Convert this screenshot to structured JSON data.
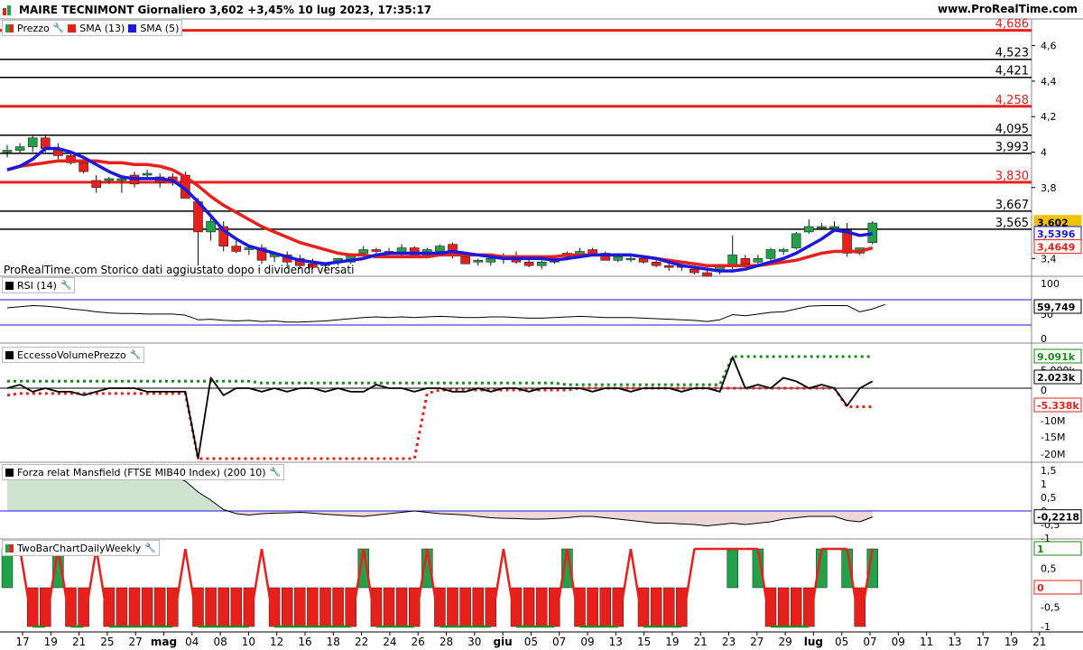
{
  "header": {
    "title": "MAIRE TECNIMONT Giornaliero 3,602 +3,45% 10 lug 2023, 17:35:17",
    "site": "www.ProRealTime.com"
  },
  "note": "ProRealTime.com  Storico dati aggiustato dopo i dividendi versati",
  "colors": {
    "up": "#22a04a",
    "down": "#e8201c",
    "sma13": "#e8201c",
    "sma5": "#1a1adc",
    "level_red": "#e8201c",
    "level_black": "#000000",
    "green_line": "#1a8a1a"
  },
  "legend": {
    "prezzo": "Prezzo",
    "sma13": "SMA (13)",
    "sma5": "SMA (5)"
  },
  "panels": {
    "rsi": {
      "label": "RSI (14)",
      "value_label": "59,749",
      "ticks": [
        "100",
        "50",
        "0"
      ]
    },
    "evp": {
      "label": "EccessoVolumePrezzo",
      "value_green": "9.091k",
      "value_black": "2.023k",
      "value_zero": "0",
      "value_red": "-5.338k",
      "ticks": [
        "5.000k",
        "-10M",
        "-15M",
        "-20M"
      ]
    },
    "mansfield": {
      "label": "Forza relat Mansfield (FTSE MIB40 Index) (200 10)",
      "value_label": "-0,2218",
      "ticks": [
        "1,5",
        "1",
        "0,5",
        "0",
        "-0,5",
        "-1"
      ]
    },
    "twobar": {
      "label": "TwoBarChartDailyWeekly",
      "value_top": "1",
      "value_zero": "0",
      "ticks": [
        "0,5",
        "-0,5",
        "-1"
      ]
    }
  },
  "x_axis": {
    "labels": [
      "17",
      "19",
      "21",
      "25",
      "27",
      "mag",
      "04",
      "08",
      "10",
      "12",
      "16",
      "18",
      "22",
      "24",
      "26",
      "28",
      "30",
      "giu",
      "05",
      "07",
      "09",
      "13",
      "15",
      "19",
      "21",
      "23",
      "27",
      "29",
      "lug",
      "05",
      "07",
      "09",
      "11",
      "13",
      "17",
      "19",
      "21"
    ],
    "bold": [
      "mag",
      "giu",
      "lug"
    ]
  },
  "chart_data": {
    "type": "candlestick",
    "price_ticks": [
      "4,6",
      "4,4",
      "4,2",
      "4",
      "3,8",
      "3,4"
    ],
    "ylim": [
      3.3,
      4.72
    ],
    "levels": [
      {
        "value": 4.686,
        "label": "4,686",
        "color": "red"
      },
      {
        "value": 4.523,
        "label": "4,523",
        "color": "black"
      },
      {
        "value": 4.421,
        "label": "4,421",
        "color": "black"
      },
      {
        "value": 4.258,
        "label": "4,258",
        "color": "red"
      },
      {
        "value": 4.095,
        "label": "4,095",
        "color": "black"
      },
      {
        "value": 3.993,
        "label": "3,993",
        "color": "black"
      },
      {
        "value": 3.83,
        "label": "3,830",
        "color": "red"
      },
      {
        "value": 3.667,
        "label": "3,667",
        "color": "black"
      },
      {
        "value": 3.565,
        "label": "3,565",
        "color": "black"
      }
    ],
    "last_price": "3,602",
    "sma5_last": "3,5396",
    "sma13_last": "3,4649",
    "candles": [
      [
        4.0,
        4.04,
        3.97,
        4.01
      ],
      [
        4.01,
        4.05,
        3.99,
        4.03
      ],
      [
        4.03,
        4.1,
        4.0,
        4.08
      ],
      [
        4.08,
        4.1,
        4.0,
        4.02
      ],
      [
        4.01,
        4.05,
        3.96,
        3.98
      ],
      [
        3.98,
        3.99,
        3.93,
        3.94
      ],
      [
        3.94,
        3.96,
        3.88,
        3.89
      ],
      [
        3.84,
        3.87,
        3.77,
        3.8
      ],
      [
        3.84,
        3.86,
        3.82,
        3.85
      ],
      [
        3.84,
        3.87,
        3.77,
        3.85
      ],
      [
        3.87,
        3.89,
        3.8,
        3.82
      ],
      [
        3.87,
        3.9,
        3.85,
        3.88
      ],
      [
        3.86,
        3.88,
        3.8,
        3.83
      ],
      [
        3.86,
        3.88,
        3.81,
        3.84
      ],
      [
        3.87,
        3.89,
        3.78,
        3.74
      ],
      [
        3.72,
        3.74,
        3.36,
        3.55
      ],
      [
        3.55,
        3.63,
        3.5,
        3.61
      ],
      [
        3.58,
        3.61,
        3.44,
        3.47
      ],
      [
        3.47,
        3.5,
        3.43,
        3.44
      ],
      [
        3.45,
        3.47,
        3.42,
        3.46
      ],
      [
        3.46,
        3.48,
        3.37,
        3.39
      ],
      [
        3.41,
        3.43,
        3.38,
        3.43
      ],
      [
        3.42,
        3.44,
        3.35,
        3.38
      ],
      [
        3.4,
        3.42,
        3.34,
        3.36
      ],
      [
        3.37,
        3.4,
        3.34,
        3.35
      ],
      [
        3.36,
        3.38,
        3.33,
        3.37
      ],
      [
        3.38,
        3.4,
        3.36,
        3.4
      ],
      [
        3.38,
        3.43,
        3.37,
        3.42
      ],
      [
        3.43,
        3.47,
        3.41,
        3.45
      ],
      [
        3.45,
        3.46,
        3.43,
        3.44
      ],
      [
        3.44,
        3.46,
        3.42,
        3.43
      ],
      [
        3.43,
        3.48,
        3.41,
        3.46
      ],
      [
        3.46,
        3.47,
        3.42,
        3.42
      ],
      [
        3.42,
        3.46,
        3.4,
        3.45
      ],
      [
        3.44,
        3.48,
        3.42,
        3.47
      ],
      [
        3.48,
        3.49,
        3.4,
        3.42
      ],
      [
        3.41,
        3.43,
        3.37,
        3.37
      ],
      [
        3.38,
        3.4,
        3.36,
        3.39
      ],
      [
        3.38,
        3.41,
        3.36,
        3.4
      ],
      [
        3.4,
        3.43,
        3.37,
        3.41
      ],
      [
        3.41,
        3.44,
        3.37,
        3.38
      ],
      [
        3.38,
        3.41,
        3.35,
        3.36
      ],
      [
        3.36,
        3.39,
        3.34,
        3.38
      ],
      [
        3.38,
        3.42,
        3.37,
        3.4
      ],
      [
        3.41,
        3.44,
        3.39,
        3.43
      ],
      [
        3.42,
        3.46,
        3.41,
        3.44
      ],
      [
        3.45,
        3.46,
        3.42,
        3.42
      ],
      [
        3.43,
        3.44,
        3.39,
        3.39
      ],
      [
        3.39,
        3.43,
        3.38,
        3.41
      ],
      [
        3.4,
        3.42,
        3.38,
        3.4
      ],
      [
        3.4,
        3.42,
        3.37,
        3.38
      ],
      [
        3.38,
        3.39,
        3.35,
        3.36
      ],
      [
        3.36,
        3.38,
        3.33,
        3.35
      ],
      [
        3.36,
        3.38,
        3.33,
        3.35
      ],
      [
        3.34,
        3.36,
        3.31,
        3.32
      ],
      [
        3.32,
        3.34,
        3.3,
        3.3
      ],
      [
        3.33,
        3.37,
        3.31,
        3.36
      ],
      [
        3.36,
        3.53,
        3.34,
        3.42
      ],
      [
        3.4,
        3.42,
        3.36,
        3.37
      ],
      [
        3.38,
        3.42,
        3.37,
        3.4
      ],
      [
        3.4,
        3.46,
        3.39,
        3.45
      ],
      [
        3.44,
        3.46,
        3.42,
        3.45
      ],
      [
        3.46,
        3.55,
        3.45,
        3.54
      ],
      [
        3.55,
        3.62,
        3.54,
        3.58
      ],
      [
        3.57,
        3.6,
        3.56,
        3.58
      ],
      [
        3.57,
        3.61,
        3.56,
        3.58
      ],
      [
        3.56,
        3.6,
        3.41,
        3.43
      ],
      [
        3.43,
        3.46,
        3.42,
        3.46
      ],
      [
        3.49,
        3.61,
        3.48,
        3.6
      ]
    ],
    "sma5": [
      3.9,
      3.92,
      3.96,
      4.02,
      4.02,
      4.0,
      3.97,
      3.93,
      3.89,
      3.86,
      3.85,
      3.85,
      3.85,
      3.84,
      3.79,
      3.72,
      3.64,
      3.56,
      3.51,
      3.47,
      3.45,
      3.43,
      3.41,
      3.39,
      3.38,
      3.37,
      3.38,
      3.39,
      3.4,
      3.42,
      3.43,
      3.43,
      3.43,
      3.43,
      3.43,
      3.44,
      3.43,
      3.42,
      3.41,
      3.4,
      3.4,
      3.4,
      3.4,
      3.39,
      3.4,
      3.41,
      3.42,
      3.42,
      3.42,
      3.42,
      3.41,
      3.4,
      3.38,
      3.36,
      3.35,
      3.34,
      3.33,
      3.33,
      3.34,
      3.36,
      3.38,
      3.4,
      3.43,
      3.47,
      3.51,
      3.56,
      3.55,
      3.53,
      3.54
    ],
    "sma13": [
      3.9,
      3.92,
      3.93,
      3.94,
      3.95,
      3.95,
      3.95,
      3.95,
      3.94,
      3.94,
      3.93,
      3.93,
      3.92,
      3.9,
      3.86,
      3.81,
      3.75,
      3.7,
      3.66,
      3.62,
      3.58,
      3.55,
      3.52,
      3.49,
      3.47,
      3.45,
      3.43,
      3.42,
      3.42,
      3.41,
      3.41,
      3.41,
      3.41,
      3.41,
      3.42,
      3.42,
      3.42,
      3.42,
      3.42,
      3.41,
      3.41,
      3.41,
      3.41,
      3.41,
      3.42,
      3.42,
      3.42,
      3.42,
      3.42,
      3.42,
      3.41,
      3.4,
      3.39,
      3.38,
      3.37,
      3.36,
      3.36,
      3.36,
      3.36,
      3.36,
      3.37,
      3.38,
      3.39,
      3.41,
      3.43,
      3.44,
      3.44,
      3.44,
      3.46
    ],
    "rsi": [
      54,
      56,
      58,
      57,
      55,
      52,
      50,
      47,
      45,
      44,
      44,
      43,
      43,
      43,
      41,
      33,
      34,
      32,
      31,
      32,
      30,
      31,
      29,
      29,
      30,
      31,
      33,
      35,
      37,
      38,
      37,
      38,
      37,
      38,
      39,
      38,
      37,
      37,
      38,
      38,
      37,
      36,
      36,
      37,
      38,
      39,
      38,
      37,
      37,
      37,
      36,
      35,
      34,
      33,
      32,
      30,
      33,
      42,
      40,
      43,
      46,
      47,
      52,
      57,
      58,
      58,
      58,
      47,
      52,
      60
    ],
    "evp_black": [
      0,
      1,
      -1,
      0,
      -1,
      -1,
      -2,
      -1,
      0,
      0,
      0,
      -1,
      -1,
      -1,
      -1,
      -20,
      3,
      -2,
      0,
      0,
      -1,
      0,
      -1,
      0,
      0,
      -1,
      0,
      -1,
      -1,
      1,
      0,
      0,
      -1,
      0,
      0,
      -1,
      -1,
      0,
      -1,
      0,
      0,
      -1,
      0,
      0,
      0,
      0,
      -1,
      0,
      0,
      -1,
      0,
      0,
      0,
      -1,
      0,
      0,
      -1,
      9,
      0,
      1,
      0,
      3,
      2,
      0,
      1,
      0,
      -5,
      0,
      2
    ],
    "evp_green": [
      2,
      2,
      2,
      2,
      2,
      2,
      2,
      2,
      2,
      2,
      2,
      2,
      2,
      2,
      2,
      2,
      2,
      2,
      2,
      2,
      1.5,
      1.5,
      1.5,
      1.5,
      1.5,
      1.5,
      1.5,
      1.5,
      1.5,
      1.5,
      1.5,
      1.5,
      1.5,
      1.5,
      1.5,
      1.5,
      1.5,
      1.5,
      1.5,
      1.5,
      1.5,
      1.5,
      1.5,
      1.5,
      1,
      1,
      1,
      1,
      1,
      1,
      1,
      1,
      1,
      1,
      1,
      1,
      1,
      9.1,
      9.1,
      9.1,
      9.1,
      9.1,
      9.1,
      9.1,
      9.1,
      9.1,
      9.1,
      9.1,
      9.1
    ],
    "evp_red": [
      -2,
      -1.5,
      -1.5,
      -1.5,
      -1.5,
      -1.5,
      -1.5,
      -1.5,
      -1.5,
      -1.5,
      -1.5,
      -1.5,
      -1.5,
      -1.5,
      -1.5,
      -20,
      -20,
      -20,
      -20,
      -20,
      -20,
      -20,
      -20,
      -20,
      -20,
      -20,
      -20,
      -20,
      -20,
      -20,
      -20,
      -20,
      -20,
      -1.5,
      -0.5,
      -0.5,
      -0.5,
      -0.5,
      -0.5,
      -0.5,
      -0.5,
      -0.5,
      -0.5,
      -0.5,
      -0.5,
      0,
      0,
      0,
      0,
      0,
      0,
      0,
      0,
      0,
      0,
      0,
      0,
      0,
      0,
      0,
      0,
      0,
      0,
      0,
      0,
      0,
      -5.3,
      -5.3,
      -5.3
    ],
    "mansfield": [
      1.5,
      1.5,
      1.5,
      1.5,
      1.45,
      1.4,
      1.38,
      1.38,
      1.42,
      1.45,
      1.5,
      1.5,
      1.45,
      1.3,
      1.1,
      0.7,
      0.4,
      0.05,
      -0.1,
      -0.15,
      -0.1,
      -0.08,
      -0.07,
      -0.05,
      -0.08,
      -0.12,
      -0.15,
      -0.18,
      -0.2,
      -0.15,
      -0.1,
      -0.05,
      0,
      -0.05,
      -0.1,
      -0.12,
      -0.15,
      -0.2,
      -0.25,
      -0.27,
      -0.28,
      -0.3,
      -0.3,
      -0.28,
      -0.25,
      -0.2,
      -0.2,
      -0.25,
      -0.3,
      -0.35,
      -0.4,
      -0.45,
      -0.45,
      -0.48,
      -0.5,
      -0.55,
      -0.5,
      -0.45,
      -0.5,
      -0.45,
      -0.4,
      -0.3,
      -0.25,
      -0.2,
      -0.2,
      -0.2,
      -0.35,
      -0.4,
      -0.22
    ],
    "twobar": [
      1,
      1,
      -1,
      -1,
      1,
      -1,
      -1,
      1,
      -1,
      -1,
      -1,
      -1,
      -1,
      -1,
      1,
      -1,
      -1,
      -1,
      -1,
      -1,
      1,
      -1,
      -1,
      -1,
      -1,
      -1,
      -1,
      -1,
      1,
      -1,
      -1,
      -1,
      -1,
      1,
      -1,
      -1,
      -1,
      -1,
      -1,
      1,
      -1,
      -1,
      -1,
      -1,
      1,
      -1,
      -1,
      -1,
      -1,
      1,
      -1,
      -1,
      -1,
      -1,
      1,
      1,
      1,
      1,
      1,
      1,
      -1,
      -1,
      -1,
      -1,
      1,
      1,
      1,
      -1,
      1
    ],
    "twobar_drawn": [
      1,
      0,
      0,
      0,
      1,
      0,
      0,
      0,
      0,
      0,
      1,
      1,
      1,
      0,
      0,
      0,
      0,
      1,
      0,
      0,
      0,
      0,
      0,
      0,
      0,
      0,
      0,
      0,
      1,
      1,
      0,
      0,
      0,
      1,
      0,
      0,
      0,
      0,
      0,
      0,
      0,
      0,
      0,
      0,
      1,
      0,
      0,
      0,
      0,
      0,
      0,
      0,
      0,
      0,
      0,
      0,
      0,
      1,
      0,
      1,
      0,
      1,
      0,
      0,
      1,
      0,
      1,
      0,
      1
    ]
  }
}
